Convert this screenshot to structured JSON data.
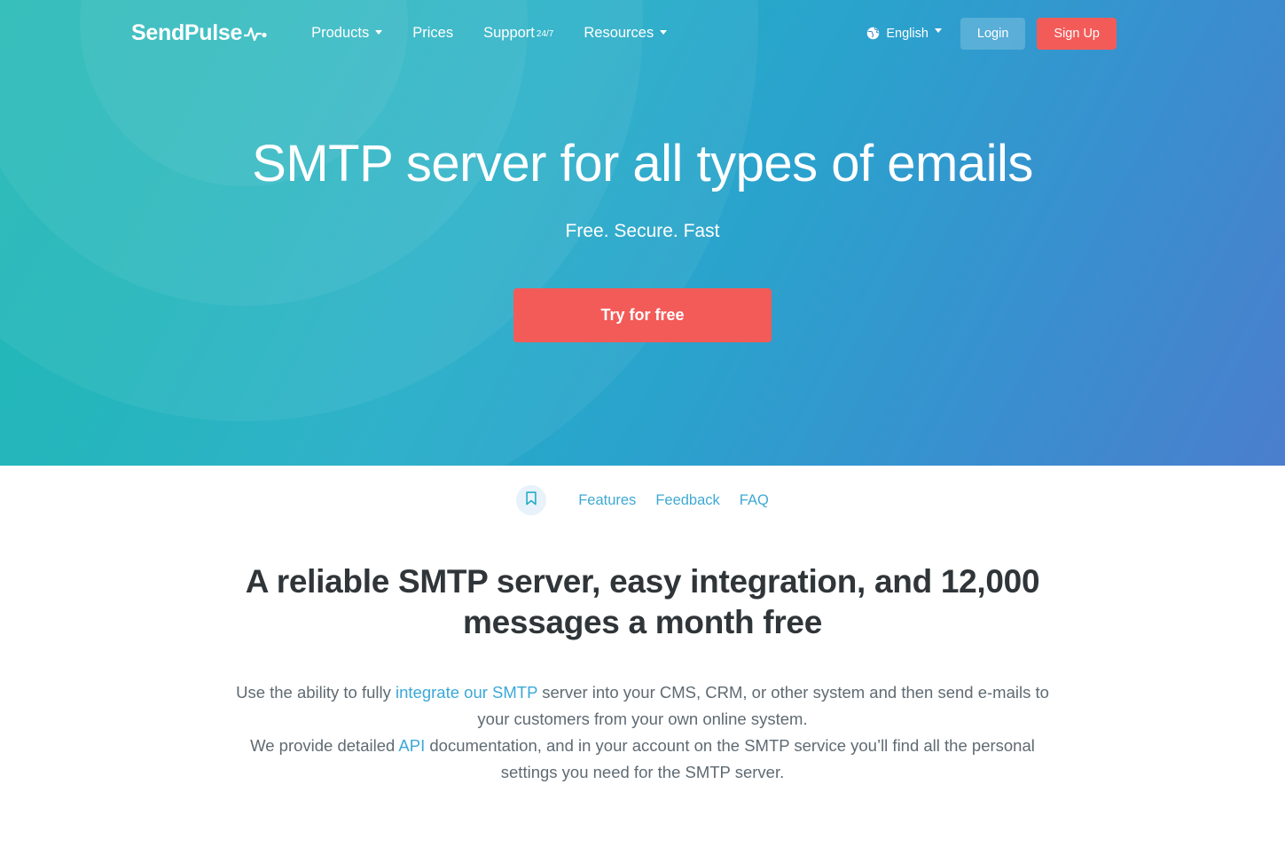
{
  "brand": {
    "name": "SendPulse",
    "logo_icon": "pulse-wave-icon",
    "accent_red": "#f35b59",
    "accent_blue": "#3aa8d8",
    "hero_gradient_start": "#14b5b0",
    "hero_gradient_end": "#4b7ece"
  },
  "nav": {
    "links": [
      {
        "label": "Products",
        "has_caret": true
      },
      {
        "label": "Prices",
        "has_caret": false
      },
      {
        "label": "Support",
        "sup": "24/7",
        "has_caret": false
      },
      {
        "label": "Resources",
        "has_caret": true
      }
    ],
    "language": {
      "icon": "globe-icon",
      "label": "English"
    },
    "login_label": "Login",
    "signup_label": "Sign Up"
  },
  "hero": {
    "title": "SMTP server for all types of emails",
    "subtitle": "Free. Secure. Fast",
    "cta_label": "Try for free"
  },
  "subnav": {
    "bookmark_icon": "bookmark-icon",
    "items": [
      {
        "label": "Features"
      },
      {
        "label": "Feedback"
      },
      {
        "label": "FAQ"
      }
    ]
  },
  "main": {
    "title": "A reliable SMTP server, easy integration, and 12,000 messages a month free",
    "paragraph_1": {
      "before": "Use the ability to fully ",
      "link": "integrate our SMTP",
      "after": " server into your CMS, CRM, or other system and then send e-mails to your customers from your own online system."
    },
    "paragraph_2": {
      "before": "We provide detailed ",
      "link": "API",
      "after": " documentation, and in your account on the SMTP service you’ll find all the personal settings you need for the SMTP server."
    }
  }
}
